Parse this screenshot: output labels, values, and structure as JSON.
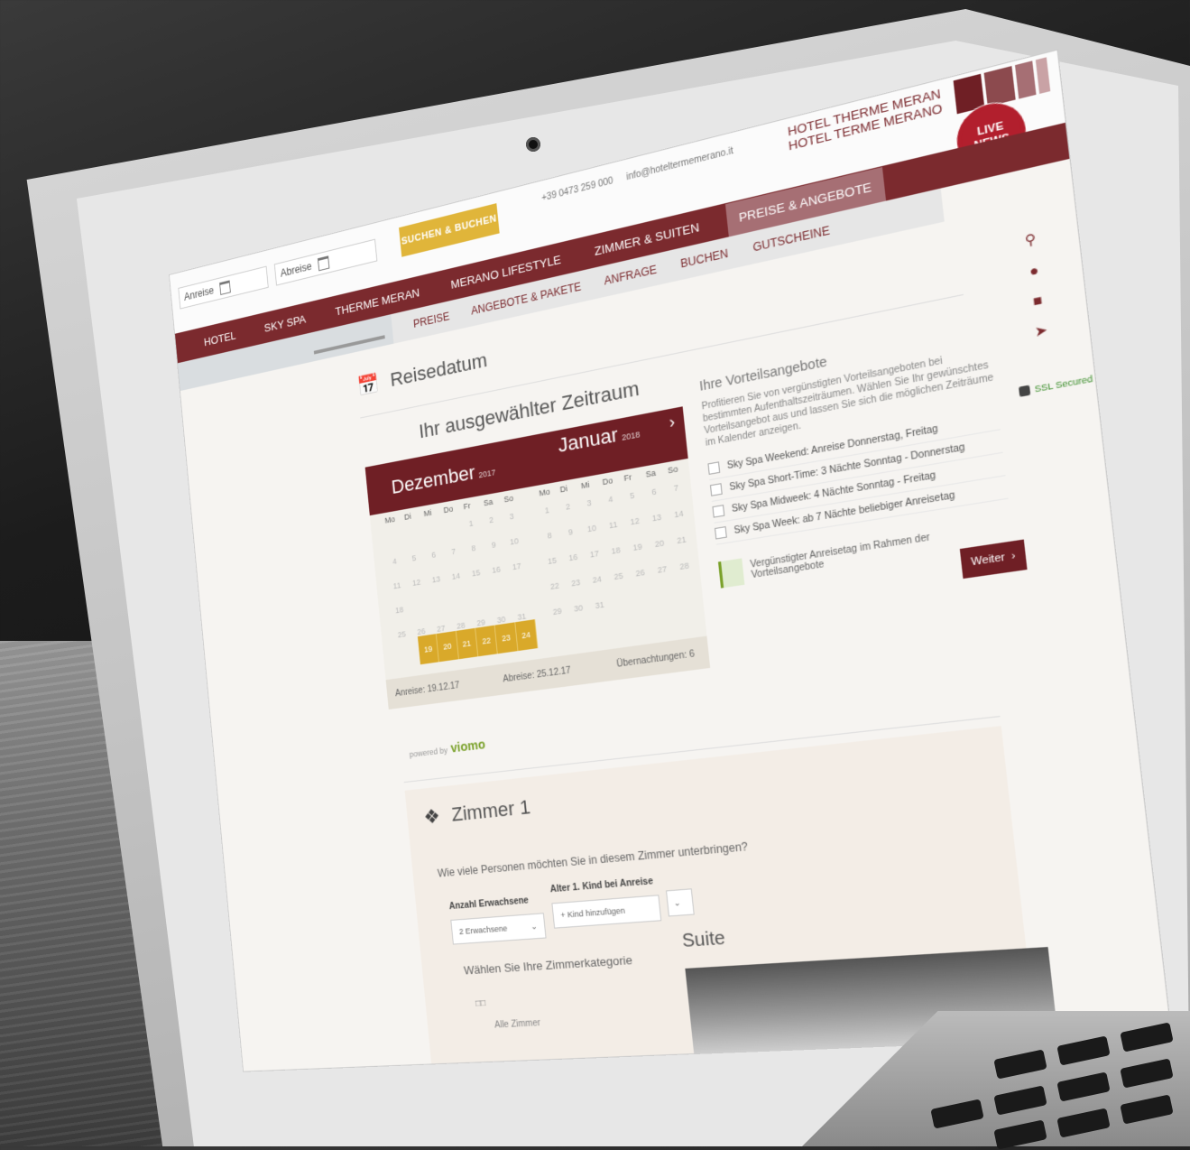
{
  "search": {
    "arrival_placeholder": "Anreise",
    "departure_placeholder": "Abreise",
    "book_label": "SUCHEN & BUCHEN"
  },
  "contact": {
    "phone": "+39 0473 259 000",
    "email": "info@hoteltermemerano.it"
  },
  "hotel": {
    "name_de": "HOTEL THERME MERAN",
    "name_it": "HOTEL TERME MERANO",
    "live_news": "LIVE NEWS"
  },
  "nav": {
    "items": [
      "HOTEL",
      "SKY SPA",
      "THERME MERAN",
      "MERANO LIFESTYLE",
      "ZIMMER & SUITEN"
    ],
    "active": "PREISE & ANGEBOTE"
  },
  "subnav": {
    "items": [
      "PREISE",
      "ANGEBOTE & PAKETE",
      "ANFRAGE",
      "BUCHEN",
      "GUTSCHEINE"
    ]
  },
  "travel": {
    "section_title": "Reisedatum",
    "period_title": "Ihr ausgewählter Zeitraum"
  },
  "calendar": {
    "month1": "Dezember",
    "month1_year": "2017",
    "month2": "Januar",
    "month2_year": "2018",
    "weekdays": [
      "Mo",
      "Di",
      "Mi",
      "Do",
      "Fr",
      "Sa",
      "So"
    ],
    "arrival": "Anreise: 19.12.17",
    "departure": "Abreise: 25.12.17",
    "nights": "Übernachtungen: 6"
  },
  "powered": {
    "prefix": "powered by",
    "brand": "viomo"
  },
  "offers": {
    "title": "Ihre Vorteilsangebote",
    "text": "Profitieren Sie von vergünstigten Vorteilsangeboten bei bestimmten Aufenthaltszeiträumen. Wählen Sie Ihr gewünschtes Vorteilsangebot aus und lassen Sie sich die möglichen Zeiträume im Kalender anzeigen.",
    "items": [
      "Sky Spa Weekend: Anreise Donnerstag, Freitag",
      "Sky Spa Short-Time: 3 Nächte Sonntag - Donnerstag",
      "Sky Spa Midweek: 4 Nächte Sonntag - Freitag",
      "Sky Spa Week: ab 7 Nächte beliebiger Anreisetag"
    ],
    "legend": "Vergünstigter Anreisetag im Rahmen der Vorteilsangebote",
    "next_label": "Weiter"
  },
  "sidebar": {
    "ssl": "SSL Secured"
  },
  "room": {
    "title": "Zimmer 1",
    "question": "Wie viele Personen möchten Sie in diesem Zimmer unterbringen?",
    "adults_label": "Anzahl Erwachsene",
    "adults_value": "2 Erwachsene",
    "child_label": "Alter 1. Kind bei Anreise",
    "child_value": "+ Kind hinzufügen",
    "category_question": "Wählen Sie Ihre Zimmerkategorie",
    "option_all": "Alle Zimmer",
    "suite": "Suite"
  }
}
